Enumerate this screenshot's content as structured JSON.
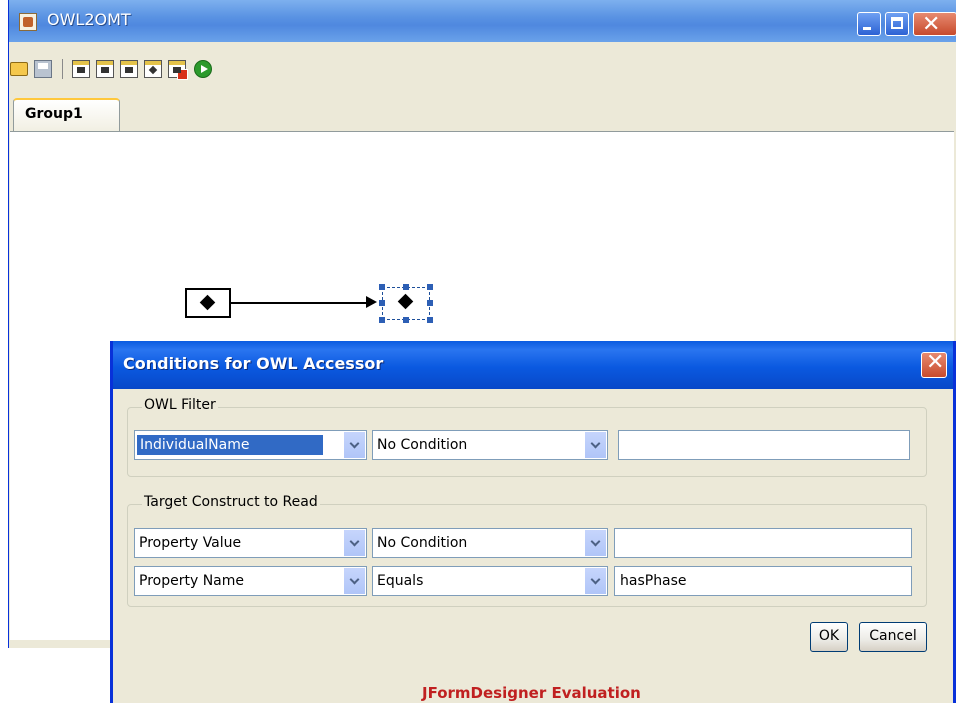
{
  "window": {
    "title": "OWL2OMT",
    "tabs": [
      {
        "label": "Group1",
        "active": true
      }
    ]
  },
  "toolbar": {
    "icons": [
      "open-icon",
      "save-icon",
      "node-icon",
      "node-icon",
      "node-icon",
      "node-icon",
      "delete-node-icon",
      "run-icon"
    ]
  },
  "dialog": {
    "title": "Conditions for OWL Accessor",
    "owl_filter": {
      "legend": "OWL Filter",
      "field": "IndividualName",
      "condition": "No Condition",
      "value": ""
    },
    "target_construct": {
      "legend": "Target Construct to Read",
      "rows": [
        {
          "field": "Property Value",
          "condition": "No Condition",
          "value": ""
        },
        {
          "field": "Property Name",
          "condition": "Equals",
          "value": "hasPhase"
        }
      ]
    },
    "ok_label": "OK",
    "cancel_label": "Cancel",
    "evaluation_notice": "JFormDesigner Evaluation"
  },
  "colors": {
    "title_bar": "#0a5be0",
    "window_bg": "#ece9d8",
    "selection": "#316ac5",
    "evaluation_text": "#c02020"
  }
}
